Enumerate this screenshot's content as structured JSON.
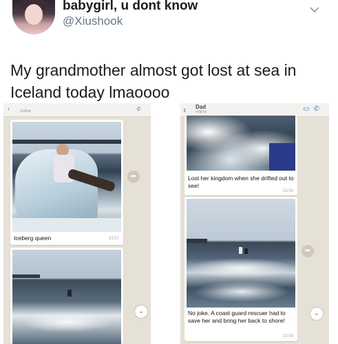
{
  "tweet": {
    "display_name": "babygirl, u dont know",
    "handle": "@Xiushook",
    "text": "My grandmother almost got lost at sea in Iceland today lmaoooo",
    "menu_icon": "chevron-down-icon"
  },
  "left_chat": {
    "status": "online",
    "messages": [
      {
        "caption": "Iceberg queen",
        "time": "23:57"
      }
    ]
  },
  "right_chat": {
    "title": "Dad",
    "status": "online",
    "messages": [
      {
        "caption": "Lost her kingdom when she drifted out to see!",
        "time": "23:58"
      },
      {
        "caption": "No joke. A coast guard rescuer had to save her and bring her back to shore!",
        "time": "23:59"
      }
    ]
  },
  "colors": {
    "chat_background": "#e6e1d6",
    "bubble": "#ffffff",
    "handle": "#657786",
    "accent_blue": "#3b83c8"
  }
}
